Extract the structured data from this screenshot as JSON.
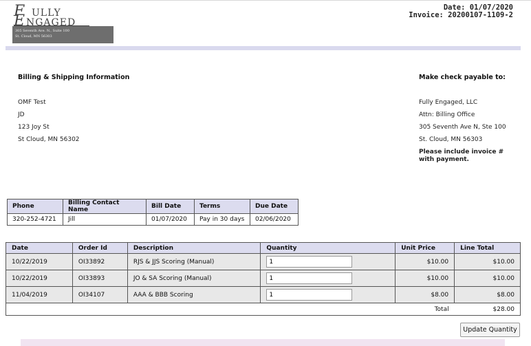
{
  "logo": {
    "line1_initial": "F",
    "line1_rest": "ULLY",
    "line2_initial": "E",
    "line2_rest": "NGAGED",
    "address_line1": "305 Seventh Ave. N., Suite 100",
    "address_line2": "St. Cloud, MN 56303"
  },
  "header": {
    "date_label": "Date:",
    "date": "01/07/2020",
    "invoice_label": "Invoice:",
    "invoice": "20200107-1109-2"
  },
  "billing": {
    "title": "Billing & Shipping Information",
    "lines": [
      "OMF Test",
      "JD",
      "123 Joy St",
      "St Cloud, MN 56302"
    ]
  },
  "payable": {
    "title": "Make check payable to:",
    "lines": [
      "Fully Engaged, LLC",
      "Attn: Billing Office",
      "305 Seventh Ave N, Ste 100",
      "St. Cloud, MN 56303"
    ],
    "note": "Please include invoice # with payment."
  },
  "info_table": {
    "headers": [
      "Phone",
      "Billing Contact Name",
      "Bill Date",
      "Terms",
      "Due Date"
    ],
    "row": [
      "320-252-4721",
      "Jill",
      "01/07/2020",
      "Pay in 30 days",
      "02/06/2020"
    ]
  },
  "items_table": {
    "headers": [
      "Date",
      "Order Id",
      "Description",
      "Quantity",
      "Unit Price",
      "Line Total"
    ],
    "rows": [
      {
        "date": "10/22/2019",
        "order_id": "OI33892",
        "description": "RJS & JJS Scoring (Manual)",
        "quantity": "1",
        "unit_price": "$10.00",
        "line_total": "$10.00"
      },
      {
        "date": "10/22/2019",
        "order_id": "OI33893",
        "description": "JO & SA Scoring (Manual)",
        "quantity": "1",
        "unit_price": "$10.00",
        "line_total": "$10.00"
      },
      {
        "date": "11/04/2019",
        "order_id": "OI34107",
        "description": "AAA & BBB Scoring",
        "quantity": "1",
        "unit_price": "$8.00",
        "line_total": "$8.00"
      }
    ],
    "total_label": "Total",
    "total_value": "$28.00"
  },
  "update_button_label": "Update Quantity",
  "colors": {
    "header_bar": "#d9d9ee",
    "table_header_bg": "#dcdcef",
    "row_bg": "#e8e8e8",
    "logo_box": "#6e6e6e"
  }
}
